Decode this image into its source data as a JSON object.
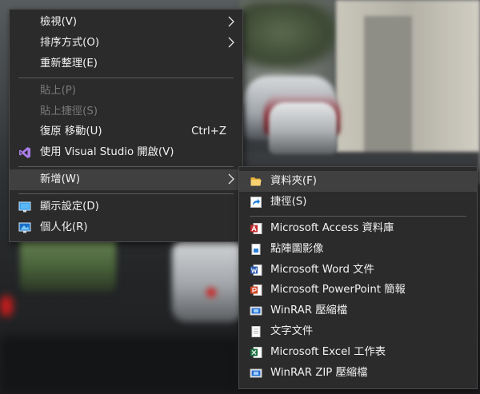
{
  "context_menu": {
    "items": [
      {
        "label": "檢視(V)"
      },
      {
        "label": "排序方式(O)"
      },
      {
        "label": "重新整理(E)"
      },
      {
        "label": "貼上(P)"
      },
      {
        "label": "貼上捷徑(S)"
      },
      {
        "label": "復原 移動(U)",
        "shortcut": "Ctrl+Z"
      },
      {
        "label": "使用 Visual Studio 開啟(V)",
        "icon": "visual-studio-icon"
      },
      {
        "label": "新增(W)"
      },
      {
        "label": "顯示設定(D)",
        "icon": "display-settings-icon"
      },
      {
        "label": "個人化(R)",
        "icon": "personalize-icon"
      }
    ]
  },
  "new_submenu": {
    "items": [
      {
        "label": "資料夾(F)",
        "icon": "folder-icon"
      },
      {
        "label": "捷徑(S)",
        "icon": "shortcut-icon"
      },
      {
        "label": "Microsoft Access 資料庫",
        "icon": "access-icon"
      },
      {
        "label": "點陣圖影像",
        "icon": "bitmap-icon"
      },
      {
        "label": "Microsoft Word 文件",
        "icon": "word-icon"
      },
      {
        "label": "Microsoft PowerPoint 簡報",
        "icon": "powerpoint-icon"
      },
      {
        "label": "WinRAR 壓縮檔",
        "icon": "winrar-icon"
      },
      {
        "label": "文字文件",
        "icon": "text-document-icon"
      },
      {
        "label": "Microsoft Excel 工作表",
        "icon": "excel-icon"
      },
      {
        "label": "WinRAR ZIP 壓縮檔",
        "icon": "winrar-zip-icon"
      }
    ]
  },
  "colors": {
    "menu_background": "#2b2b2b",
    "menu_highlight": "#404040",
    "menu_text": "#f2f2f2",
    "menu_disabled_text": "#7a7a7a"
  }
}
